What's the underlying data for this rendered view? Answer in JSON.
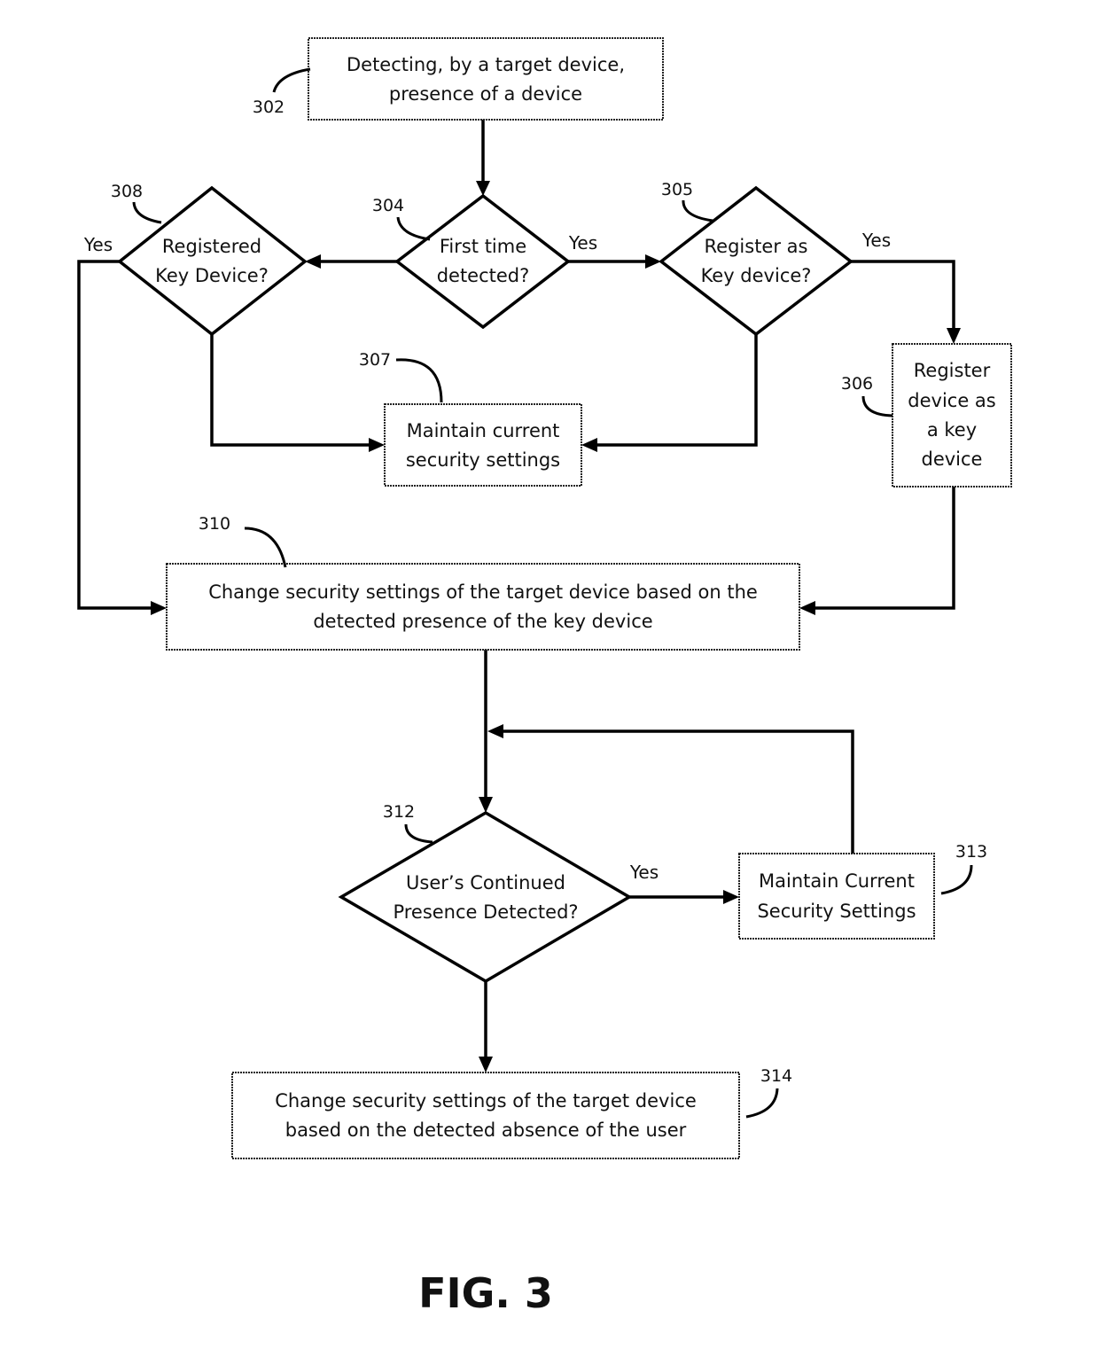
{
  "figure": {
    "caption": "FIG. 3",
    "nodes": {
      "n302": {
        "ref": "302",
        "type": "process",
        "lines": [
          "Detecting, by a target device,",
          "presence of a device"
        ]
      },
      "n304": {
        "ref": "304",
        "type": "decision",
        "lines": [
          "First time",
          "detected?"
        ]
      },
      "n305": {
        "ref": "305",
        "type": "decision",
        "lines": [
          "Register as",
          "Key device?"
        ]
      },
      "n306": {
        "ref": "306",
        "type": "process",
        "lines": [
          "Register",
          "device as",
          "a key",
          "device"
        ]
      },
      "n307": {
        "ref": "307",
        "type": "process",
        "lines": [
          "Maintain current",
          "security settings"
        ]
      },
      "n308": {
        "ref": "308",
        "type": "decision",
        "lines": [
          "Registered",
          "Key Device?"
        ]
      },
      "n310": {
        "ref": "310",
        "type": "process",
        "lines": [
          "Change security settings of the target device based on the",
          "detected presence of the key device"
        ]
      },
      "n312": {
        "ref": "312",
        "type": "decision",
        "lines": [
          "User’s Continued",
          "Presence Detected?"
        ]
      },
      "n313": {
        "ref": "313",
        "type": "process",
        "lines": [
          "Maintain Current",
          "Security Settings"
        ]
      },
      "n314": {
        "ref": "314",
        "type": "process",
        "lines": [
          "Change security settings of the target device",
          "based on the detected absence of the user"
        ]
      }
    },
    "edges": [
      {
        "from": "302",
        "to": "304",
        "label": ""
      },
      {
        "from": "304",
        "to": "305",
        "label": "Yes"
      },
      {
        "from": "304",
        "to": "308",
        "label": ""
      },
      {
        "from": "305",
        "to": "306",
        "label": "Yes"
      },
      {
        "from": "305",
        "to": "307",
        "label": ""
      },
      {
        "from": "308",
        "to": "307",
        "label": ""
      },
      {
        "from": "308",
        "to": "310",
        "label": "Yes"
      },
      {
        "from": "306",
        "to": "310",
        "label": ""
      },
      {
        "from": "310",
        "to": "312",
        "label": ""
      },
      {
        "from": "312",
        "to": "313",
        "label": "Yes"
      },
      {
        "from": "313",
        "to": "312",
        "label": ""
      },
      {
        "from": "312",
        "to": "314",
        "label": ""
      }
    ],
    "edge_labels": {
      "yes_304": "Yes",
      "yes_305": "Yes",
      "yes_308": "Yes",
      "yes_312": "Yes"
    }
  }
}
